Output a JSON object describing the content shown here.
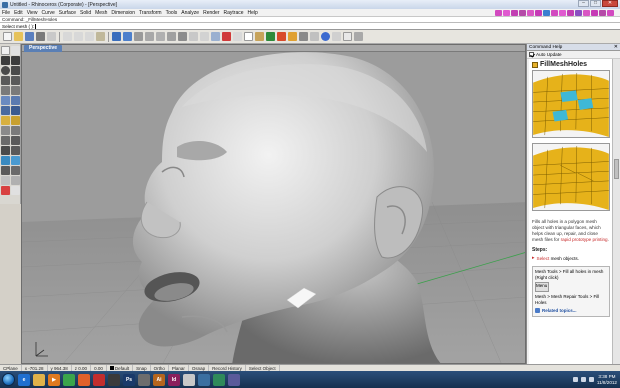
{
  "window": {
    "title": "Untitled - Rhinoceros (Corporate) - [Perspective]",
    "controls": [
      "–",
      "□",
      "✕"
    ]
  },
  "menu": {
    "items": [
      "File",
      "Edit",
      "View",
      "Curve",
      "Surface",
      "Solid",
      "Mesh",
      "Dimension",
      "Transform",
      "Tools",
      "Analyze",
      "Render",
      "Raytrace",
      "Help"
    ]
  },
  "command": {
    "history": "Command: _FillMeshHoles",
    "prompt": "Select mesh ( ):"
  },
  "viewport": {
    "tab_label": "Perspective",
    "background_color": "#9b9b9b",
    "axis_icon": "world-axis-icon"
  },
  "help_panel": {
    "header": "Command Help",
    "auto_update_label": "Auto Update",
    "auto_update_checked": true,
    "command_title": "FillMeshHoles",
    "description_prefix": "Fills all holes in a polygon mesh object with triangular faces, which helps clean up, repair, and close mesh files for ",
    "description_link": "rapid prototype printing",
    "description_suffix": ".",
    "steps_heading": "Steps:",
    "step_prefix": "Select",
    "step_highlight": " mesh objects.",
    "menu_path_1": "Mesh Tools > Fill all holes in mesh (Right click)",
    "menu_thumb_label": "Menu",
    "menu_path_2": "Mesh > Mesh Repair Tools > Fill Holes",
    "related_link": "Related topics..."
  },
  "status": {
    "cplane": "CPlane",
    "x": "x -701.28",
    "y": "y 964.38",
    "z": "z 0.00",
    "value": "0.00",
    "layer": "Default",
    "toggles": [
      "Snap",
      "Ortho",
      "Planar",
      "Osnap",
      "Record History",
      "Select Object"
    ]
  },
  "taskbar": {
    "apps": [
      {
        "name": "ie-icon",
        "label": "e",
        "color": "#1f6fd0"
      },
      {
        "name": "explorer-icon",
        "label": "",
        "color": "#e0b24a"
      },
      {
        "name": "media-player-icon",
        "label": "▶",
        "color": "#e07a1f"
      },
      {
        "name": "chrome-icon",
        "label": "",
        "color": "#3aa54b"
      },
      {
        "name": "firefox-icon",
        "label": "",
        "color": "#e0612a"
      },
      {
        "name": "pdf-icon",
        "label": "",
        "color": "#c22d2d"
      },
      {
        "name": "rhino-icon",
        "label": "",
        "color": "#3b3b3b"
      },
      {
        "name": "photoshop-icon",
        "label": "Ps",
        "color": "#1a3a6a"
      },
      {
        "name": "app-icon",
        "label": "",
        "color": "#6d6d6d"
      },
      {
        "name": "illustrator-icon",
        "label": "Ai",
        "color": "#b5651d"
      },
      {
        "name": "indesign-icon",
        "label": "Id",
        "color": "#8a1f5c"
      },
      {
        "name": "acrobat-icon",
        "label": "",
        "color": "#c8c8c8"
      },
      {
        "name": "app2-icon",
        "label": "",
        "color": "#3b6fa0"
      },
      {
        "name": "app3-icon",
        "label": "",
        "color": "#2f8a5a"
      },
      {
        "name": "app4-icon",
        "label": "",
        "color": "#5a5a9a"
      }
    ],
    "time": "3:38 PM",
    "date": "11/8/2012"
  }
}
